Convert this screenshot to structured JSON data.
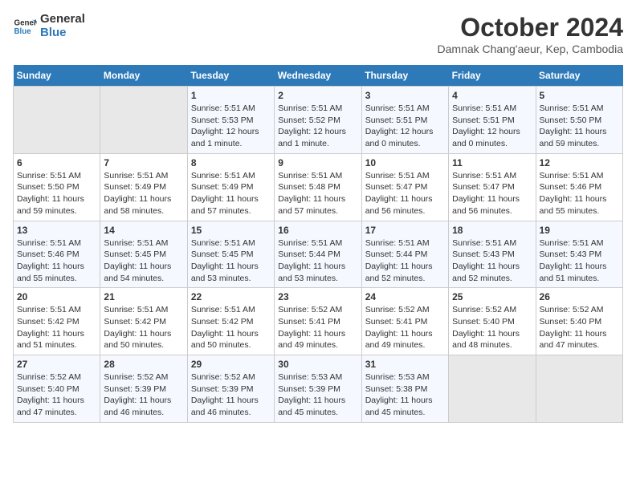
{
  "header": {
    "logo_line1": "General",
    "logo_line2": "Blue",
    "title": "October 2024",
    "location": "Damnak Chang'aeur, Kep, Cambodia"
  },
  "weekdays": [
    "Sunday",
    "Monday",
    "Tuesday",
    "Wednesday",
    "Thursday",
    "Friday",
    "Saturday"
  ],
  "weeks": [
    [
      {
        "day": "",
        "info": ""
      },
      {
        "day": "",
        "info": ""
      },
      {
        "day": "1",
        "info": "Sunrise: 5:51 AM\nSunset: 5:53 PM\nDaylight: 12 hours and 1 minute."
      },
      {
        "day": "2",
        "info": "Sunrise: 5:51 AM\nSunset: 5:52 PM\nDaylight: 12 hours and 1 minute."
      },
      {
        "day": "3",
        "info": "Sunrise: 5:51 AM\nSunset: 5:51 PM\nDaylight: 12 hours and 0 minutes."
      },
      {
        "day": "4",
        "info": "Sunrise: 5:51 AM\nSunset: 5:51 PM\nDaylight: 12 hours and 0 minutes."
      },
      {
        "day": "5",
        "info": "Sunrise: 5:51 AM\nSunset: 5:50 PM\nDaylight: 11 hours and 59 minutes."
      }
    ],
    [
      {
        "day": "6",
        "info": "Sunrise: 5:51 AM\nSunset: 5:50 PM\nDaylight: 11 hours and 59 minutes."
      },
      {
        "day": "7",
        "info": "Sunrise: 5:51 AM\nSunset: 5:49 PM\nDaylight: 11 hours and 58 minutes."
      },
      {
        "day": "8",
        "info": "Sunrise: 5:51 AM\nSunset: 5:49 PM\nDaylight: 11 hours and 57 minutes."
      },
      {
        "day": "9",
        "info": "Sunrise: 5:51 AM\nSunset: 5:48 PM\nDaylight: 11 hours and 57 minutes."
      },
      {
        "day": "10",
        "info": "Sunrise: 5:51 AM\nSunset: 5:47 PM\nDaylight: 11 hours and 56 minutes."
      },
      {
        "day": "11",
        "info": "Sunrise: 5:51 AM\nSunset: 5:47 PM\nDaylight: 11 hours and 56 minutes."
      },
      {
        "day": "12",
        "info": "Sunrise: 5:51 AM\nSunset: 5:46 PM\nDaylight: 11 hours and 55 minutes."
      }
    ],
    [
      {
        "day": "13",
        "info": "Sunrise: 5:51 AM\nSunset: 5:46 PM\nDaylight: 11 hours and 55 minutes."
      },
      {
        "day": "14",
        "info": "Sunrise: 5:51 AM\nSunset: 5:45 PM\nDaylight: 11 hours and 54 minutes."
      },
      {
        "day": "15",
        "info": "Sunrise: 5:51 AM\nSunset: 5:45 PM\nDaylight: 11 hours and 53 minutes."
      },
      {
        "day": "16",
        "info": "Sunrise: 5:51 AM\nSunset: 5:44 PM\nDaylight: 11 hours and 53 minutes."
      },
      {
        "day": "17",
        "info": "Sunrise: 5:51 AM\nSunset: 5:44 PM\nDaylight: 11 hours and 52 minutes."
      },
      {
        "day": "18",
        "info": "Sunrise: 5:51 AM\nSunset: 5:43 PM\nDaylight: 11 hours and 52 minutes."
      },
      {
        "day": "19",
        "info": "Sunrise: 5:51 AM\nSunset: 5:43 PM\nDaylight: 11 hours and 51 minutes."
      }
    ],
    [
      {
        "day": "20",
        "info": "Sunrise: 5:51 AM\nSunset: 5:42 PM\nDaylight: 11 hours and 51 minutes."
      },
      {
        "day": "21",
        "info": "Sunrise: 5:51 AM\nSunset: 5:42 PM\nDaylight: 11 hours and 50 minutes."
      },
      {
        "day": "22",
        "info": "Sunrise: 5:51 AM\nSunset: 5:42 PM\nDaylight: 11 hours and 50 minutes."
      },
      {
        "day": "23",
        "info": "Sunrise: 5:52 AM\nSunset: 5:41 PM\nDaylight: 11 hours and 49 minutes."
      },
      {
        "day": "24",
        "info": "Sunrise: 5:52 AM\nSunset: 5:41 PM\nDaylight: 11 hours and 49 minutes."
      },
      {
        "day": "25",
        "info": "Sunrise: 5:52 AM\nSunset: 5:40 PM\nDaylight: 11 hours and 48 minutes."
      },
      {
        "day": "26",
        "info": "Sunrise: 5:52 AM\nSunset: 5:40 PM\nDaylight: 11 hours and 47 minutes."
      }
    ],
    [
      {
        "day": "27",
        "info": "Sunrise: 5:52 AM\nSunset: 5:40 PM\nDaylight: 11 hours and 47 minutes."
      },
      {
        "day": "28",
        "info": "Sunrise: 5:52 AM\nSunset: 5:39 PM\nDaylight: 11 hours and 46 minutes."
      },
      {
        "day": "29",
        "info": "Sunrise: 5:52 AM\nSunset: 5:39 PM\nDaylight: 11 hours and 46 minutes."
      },
      {
        "day": "30",
        "info": "Sunrise: 5:53 AM\nSunset: 5:39 PM\nDaylight: 11 hours and 45 minutes."
      },
      {
        "day": "31",
        "info": "Sunrise: 5:53 AM\nSunset: 5:38 PM\nDaylight: 11 hours and 45 minutes."
      },
      {
        "day": "",
        "info": ""
      },
      {
        "day": "",
        "info": ""
      }
    ]
  ]
}
